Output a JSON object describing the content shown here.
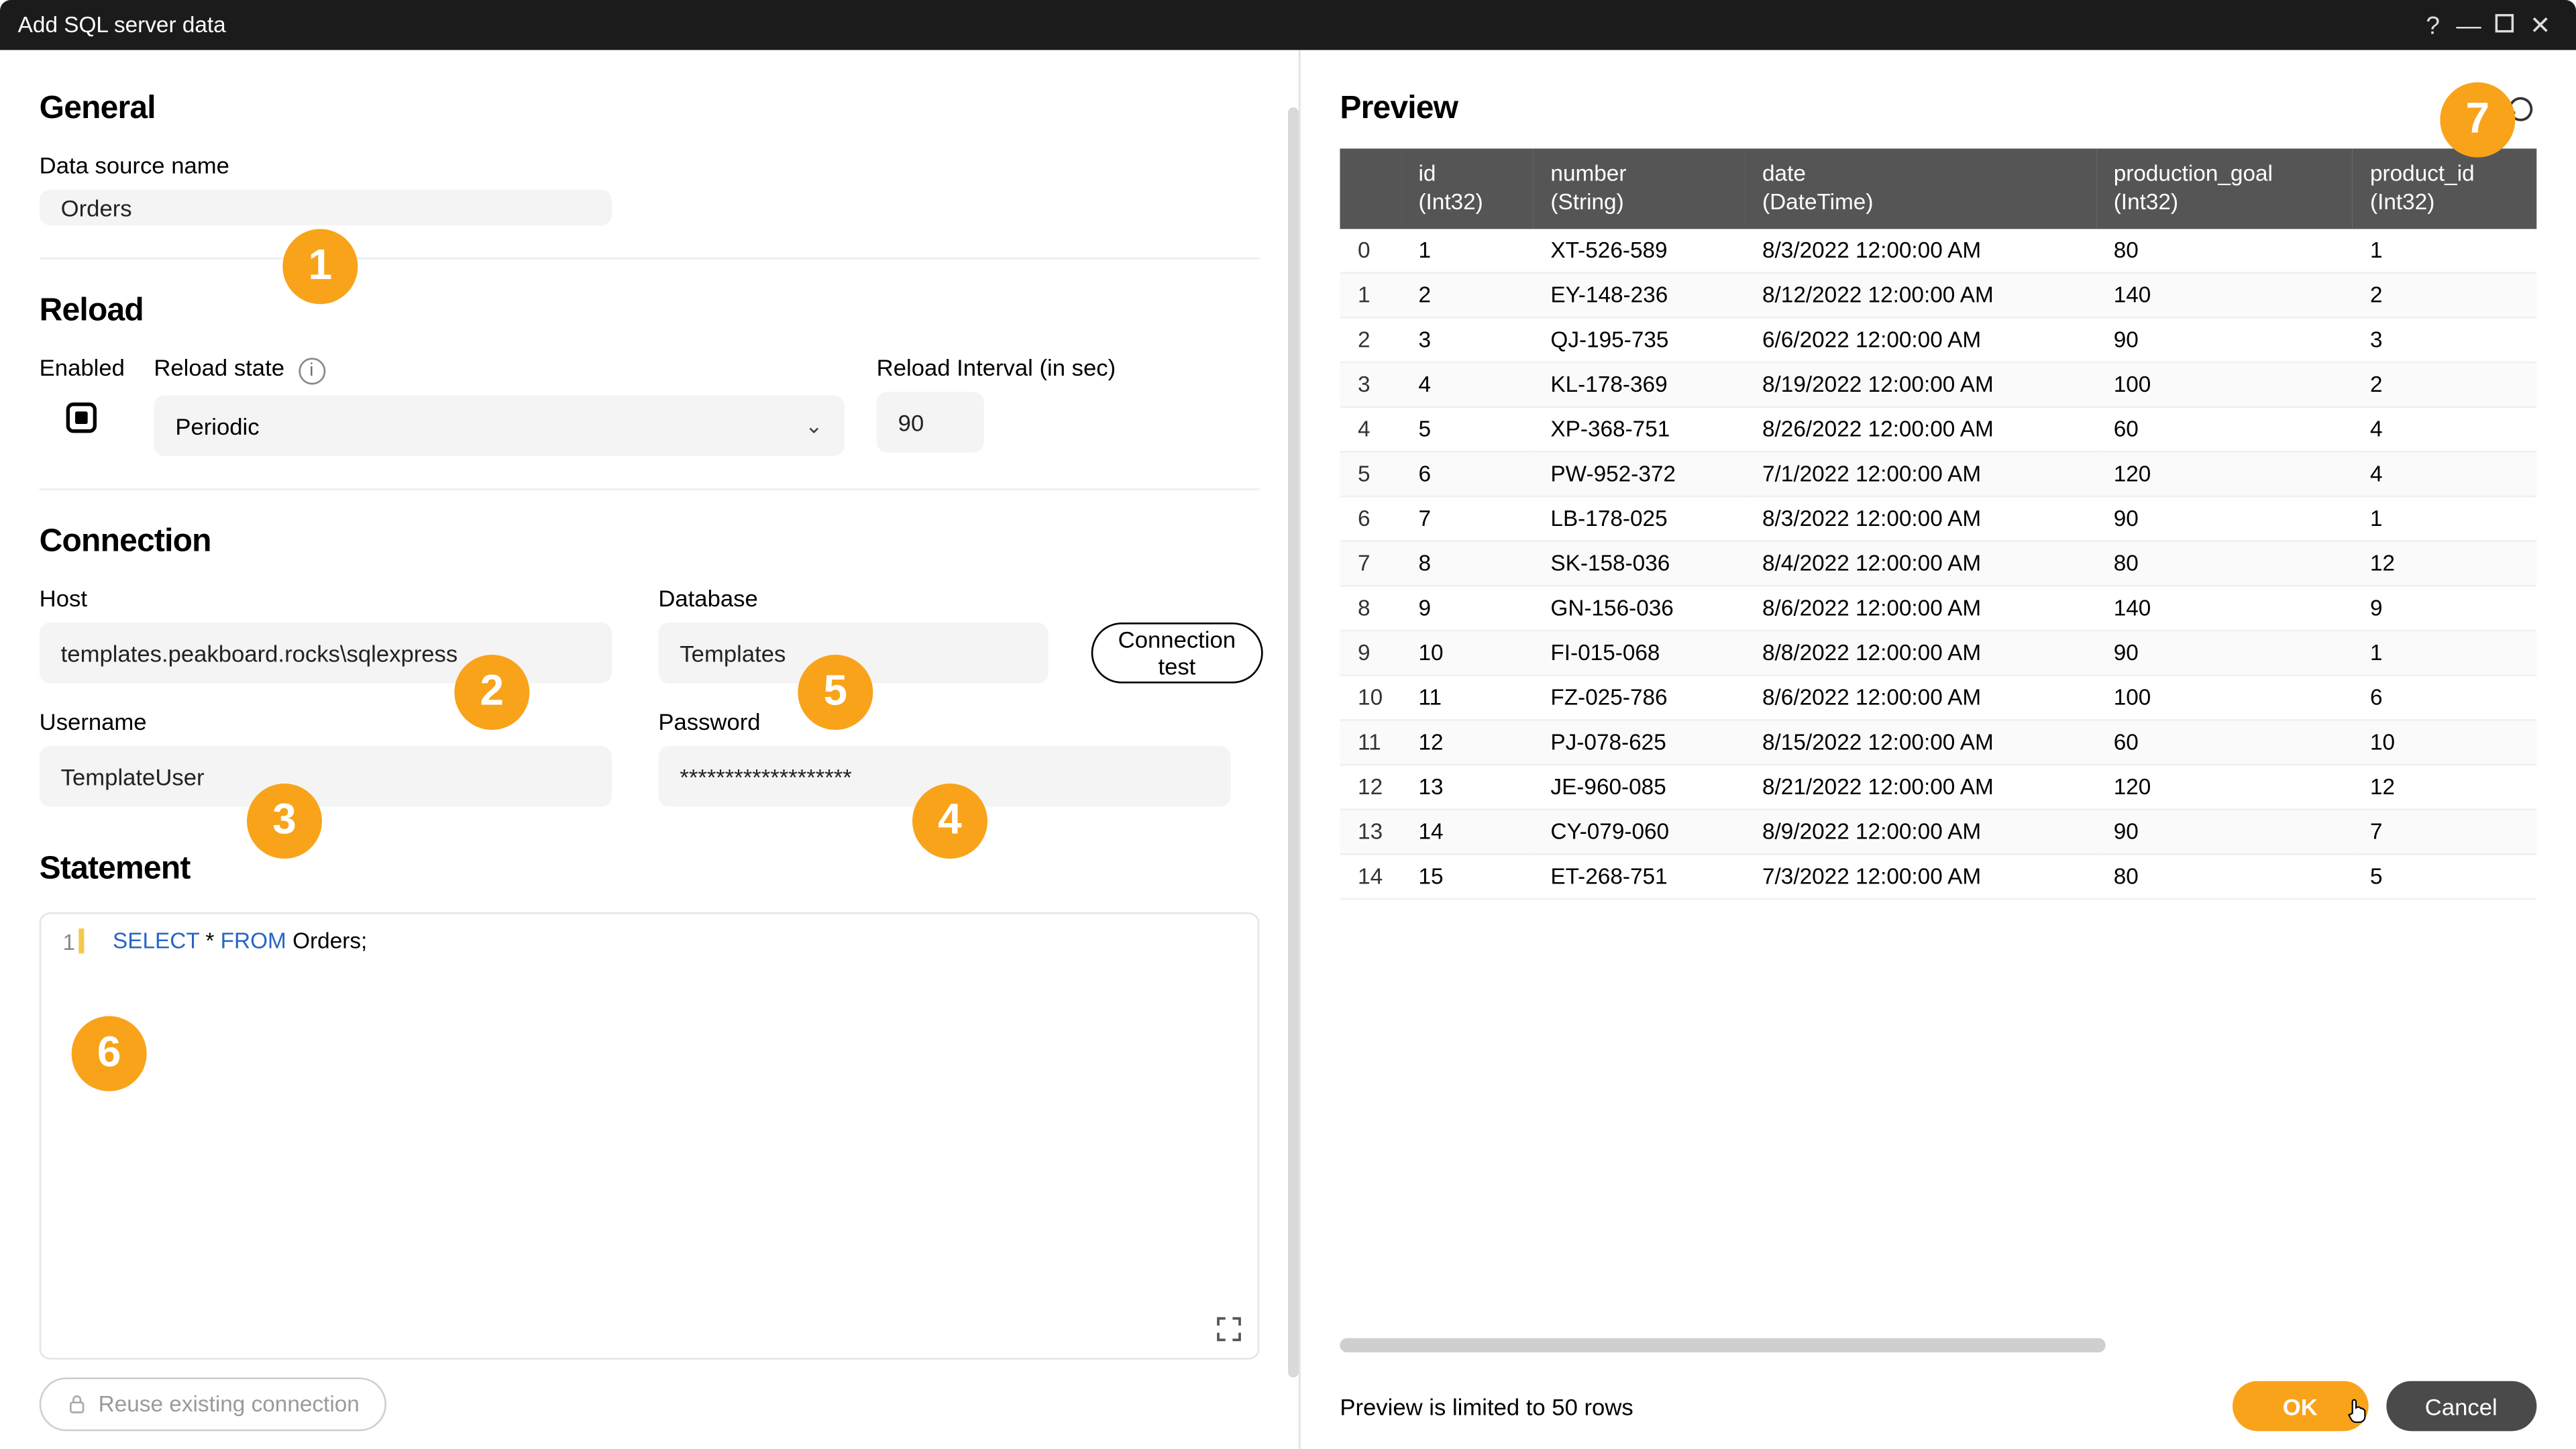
{
  "window": {
    "title": "Add SQL server data"
  },
  "general": {
    "heading": "General",
    "data_source_name_label": "Data source name",
    "data_source_name_value": "Orders"
  },
  "reload": {
    "heading": "Reload",
    "enabled_label": "Enabled",
    "state_label": "Reload state",
    "state_value": "Periodic",
    "interval_label": "Reload Interval (in sec)",
    "interval_value": "90"
  },
  "connection": {
    "heading": "Connection",
    "host_label": "Host",
    "host_value": "templates.peakboard.rocks\\sqlexpress",
    "database_label": "Database",
    "database_value": "Templates",
    "username_label": "Username",
    "username_value": "TemplateUser",
    "password_label": "Password",
    "password_value": "*******************",
    "test_button": "Connection test"
  },
  "statement": {
    "heading": "Statement",
    "line_number": "1",
    "sql_select": "SELECT",
    "sql_star": "*",
    "sql_from": "FROM",
    "sql_rest": "Orders;"
  },
  "reuse_button": "Reuse existing connection",
  "preview": {
    "heading": "Preview",
    "limit_note": "Preview is limited to 50 rows",
    "columns": [
      {
        "name": "id",
        "type": "(Int32)"
      },
      {
        "name": "number",
        "type": "(String)"
      },
      {
        "name": "date",
        "type": "(DateTime)"
      },
      {
        "name": "production_goal",
        "type": "(Int32)"
      },
      {
        "name": "product_id",
        "type": "(Int32)"
      }
    ],
    "rows": [
      {
        "idx": "0",
        "id": "1",
        "number": "XT-526-589",
        "date": "8/3/2022 12:00:00 AM",
        "production_goal": "80",
        "product_id": "1"
      },
      {
        "idx": "1",
        "id": "2",
        "number": "EY-148-236",
        "date": "8/12/2022 12:00:00 AM",
        "production_goal": "140",
        "product_id": "2"
      },
      {
        "idx": "2",
        "id": "3",
        "number": "QJ-195-735",
        "date": "6/6/2022 12:00:00 AM",
        "production_goal": "90",
        "product_id": "3"
      },
      {
        "idx": "3",
        "id": "4",
        "number": "KL-178-369",
        "date": "8/19/2022 12:00:00 AM",
        "production_goal": "100",
        "product_id": "2"
      },
      {
        "idx": "4",
        "id": "5",
        "number": "XP-368-751",
        "date": "8/26/2022 12:00:00 AM",
        "production_goal": "60",
        "product_id": "4"
      },
      {
        "idx": "5",
        "id": "6",
        "number": "PW-952-372",
        "date": "7/1/2022 12:00:00 AM",
        "production_goal": "120",
        "product_id": "4"
      },
      {
        "idx": "6",
        "id": "7",
        "number": "LB-178-025",
        "date": "8/3/2022 12:00:00 AM",
        "production_goal": "90",
        "product_id": "1"
      },
      {
        "idx": "7",
        "id": "8",
        "number": "SK-158-036",
        "date": "8/4/2022 12:00:00 AM",
        "production_goal": "80",
        "product_id": "12"
      },
      {
        "idx": "8",
        "id": "9",
        "number": "GN-156-036",
        "date": "8/6/2022 12:00:00 AM",
        "production_goal": "140",
        "product_id": "9"
      },
      {
        "idx": "9",
        "id": "10",
        "number": "FI-015-068",
        "date": "8/8/2022 12:00:00 AM",
        "production_goal": "90",
        "product_id": "1"
      },
      {
        "idx": "10",
        "id": "11",
        "number": "FZ-025-786",
        "date": "8/6/2022 12:00:00 AM",
        "production_goal": "100",
        "product_id": "6"
      },
      {
        "idx": "11",
        "id": "12",
        "number": "PJ-078-625",
        "date": "8/15/2022 12:00:00 AM",
        "production_goal": "60",
        "product_id": "10"
      },
      {
        "idx": "12",
        "id": "13",
        "number": "JE-960-085",
        "date": "8/21/2022 12:00:00 AM",
        "production_goal": "120",
        "product_id": "12"
      },
      {
        "idx": "13",
        "id": "14",
        "number": "CY-079-060",
        "date": "8/9/2022 12:00:00 AM",
        "production_goal": "90",
        "product_id": "7"
      },
      {
        "idx": "14",
        "id": "15",
        "number": "ET-268-751",
        "date": "7/3/2022 12:00:00 AM",
        "production_goal": "80",
        "product_id": "5"
      }
    ]
  },
  "footer": {
    "ok_label": "OK",
    "cancel_label": "Cancel"
  },
  "callouts": {
    "c1": "1",
    "c2": "2",
    "c3": "3",
    "c4": "4",
    "c5": "5",
    "c6": "6",
    "c7": "7"
  }
}
